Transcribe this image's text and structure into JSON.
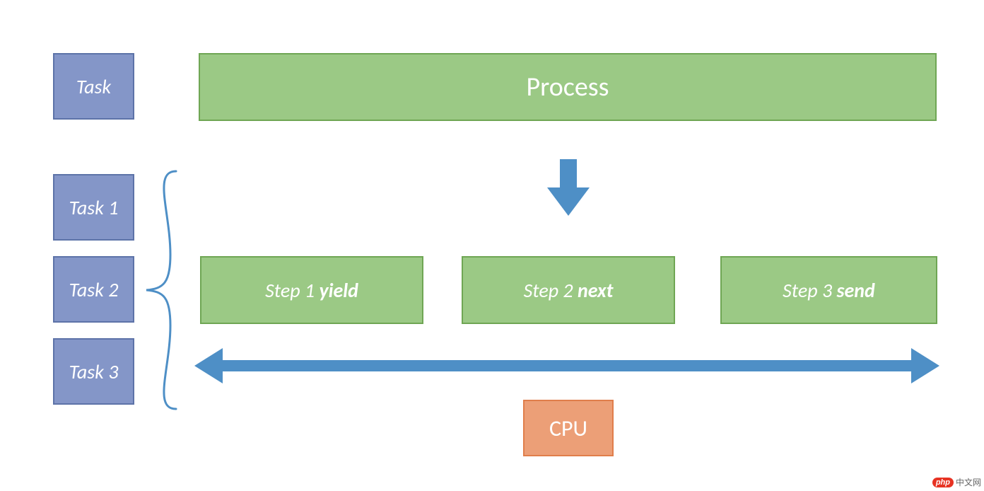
{
  "diagram": {
    "task": "Task",
    "process": "Process",
    "tasks": [
      "Task 1",
      "Task 2",
      "Task 3"
    ],
    "steps": [
      {
        "prefix": "Step 1 ",
        "keyword": "yield"
      },
      {
        "prefix": "Step 2 ",
        "keyword": "next"
      },
      {
        "prefix": "Step 3 ",
        "keyword": "send"
      }
    ],
    "cpu": "CPU",
    "colors": {
      "blue_fill": "#8496c8",
      "blue_border": "#5d73a8",
      "green_fill": "#9bc985",
      "green_border": "#6fa654",
      "orange_fill": "#ec9f77",
      "orange_border": "#e07e4b",
      "arrow": "#4e8fc6"
    }
  },
  "watermark": {
    "badge": "php",
    "text": "中文网"
  }
}
